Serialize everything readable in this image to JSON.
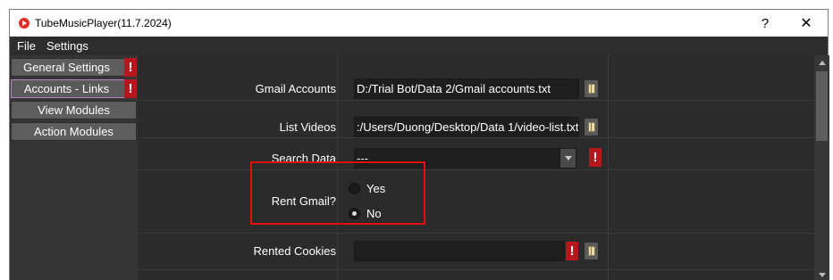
{
  "window": {
    "title": "TubeMusicPlayer(11.7.2024)",
    "help_label": "?",
    "close_label": "✕"
  },
  "menu": {
    "items": [
      {
        "label": "File"
      },
      {
        "label": "Settings"
      }
    ]
  },
  "sidebar": {
    "items": [
      {
        "label": "General Settings",
        "alert": "!",
        "active": false
      },
      {
        "label": "Accounts - Links",
        "alert": "!",
        "active": true
      },
      {
        "label": "View Modules",
        "active": false
      },
      {
        "label": "Action Modules",
        "active": false
      }
    ]
  },
  "form": {
    "gmail_accounts": {
      "label": "Gmail Accounts",
      "value": "D:/Trial Bot/Data 2/Gmail accounts.txt"
    },
    "list_videos": {
      "label": "List Videos",
      "value": ":/Users/Duong/Desktop/Data 1/video-list.txt"
    },
    "search_data": {
      "label": "Search Data",
      "value": "---",
      "alert": "!"
    },
    "rent_gmail": {
      "label": "Rent Gmail?",
      "options": [
        {
          "label": "Yes",
          "checked": false
        },
        {
          "label": "No",
          "checked": true
        }
      ]
    },
    "rented_cookies": {
      "label": "Rented Cookies",
      "value": "",
      "alert": "!"
    }
  },
  "colors": {
    "alert": "#b8161c",
    "highlight": "#e01010",
    "active_border": "#b787c8",
    "panel_bg": "#2b2b2b"
  },
  "icons": {
    "app": "app-logo-icon",
    "browse": "folder-icon",
    "dropdown": "chevron-down-icon"
  }
}
